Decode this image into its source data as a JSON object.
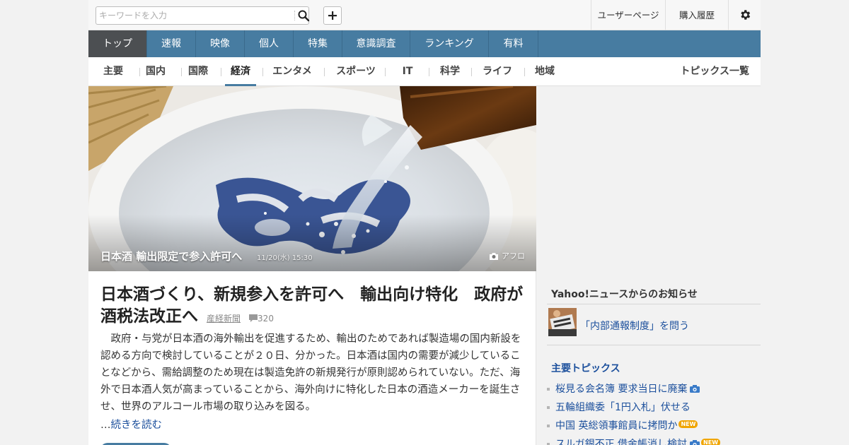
{
  "search": {
    "placeholder": "キーワードを入力"
  },
  "header_links": {
    "user_page": "ユーザーページ",
    "purchase_history": "購入履歴"
  },
  "main_nav": [
    {
      "label": "トップ",
      "active": true
    },
    {
      "label": "速報"
    },
    {
      "label": "映像"
    },
    {
      "label": "個人"
    },
    {
      "label": "特集"
    },
    {
      "label": "意識調査"
    },
    {
      "label": "ランキング"
    },
    {
      "label": "有料"
    }
  ],
  "sub_nav": [
    {
      "label": "主要"
    },
    {
      "label": "国内"
    },
    {
      "label": "国際"
    },
    {
      "label": "経済",
      "active": true
    },
    {
      "label": "エンタメ"
    },
    {
      "label": "スポーツ"
    },
    {
      "label": "IT"
    },
    {
      "label": "科学"
    },
    {
      "label": "ライフ"
    },
    {
      "label": "地域"
    }
  ],
  "topic_list_link": "トピックス一覧",
  "hero": {
    "caption": "日本酒 輸出限定で参入許可へ",
    "date": "11/20(水) 15:30",
    "credit": "アフロ"
  },
  "article": {
    "headline": "日本酒づくり、新規参入を許可へ　輸出向け特化　政府が酒税法改正へ",
    "source": "産経新聞",
    "comments": "320",
    "body": "　政府・与党が日本酒の海外輸出を促進するため、輸出のためであれば製造場の国内新設を認める方向で検討していることが２０日、分かった。日本酒は国内の需要が減少していることなどから、需給調整のため現在は製造免許の新規発行が原則認められていない。ただ、海外で日本酒人気が高まっていることから、海外向けに特化した日本の酒造メーカーを誕生させ、世界のアルコール市場の取り込みを図る。",
    "more_prefix": "…",
    "more_label": "続きを読む"
  },
  "sidebar": {
    "notice_title": "Yahoo!ニュースからのお知らせ",
    "notice_item": "「内部通報制度」を問う",
    "topics_title": "主要トピックス",
    "topics": [
      {
        "text": "桜見る会名簿 要求当日に廃棄",
        "camera": true,
        "new": false
      },
      {
        "text": "五輪組織委「1円入札」伏せる",
        "camera": false,
        "new": false
      },
      {
        "text": "中国 英総領事館員に拷問か",
        "camera": false,
        "new": true
      },
      {
        "text": "スルガ銀不正 借金帳消し検討",
        "camera": true,
        "new": true
      }
    ],
    "new_badge": "NEW"
  },
  "colors": {
    "nav": "#477ca1",
    "nav_active": "#4c4f52",
    "link": "#1b4f9c",
    "badge": "#f0a500"
  }
}
